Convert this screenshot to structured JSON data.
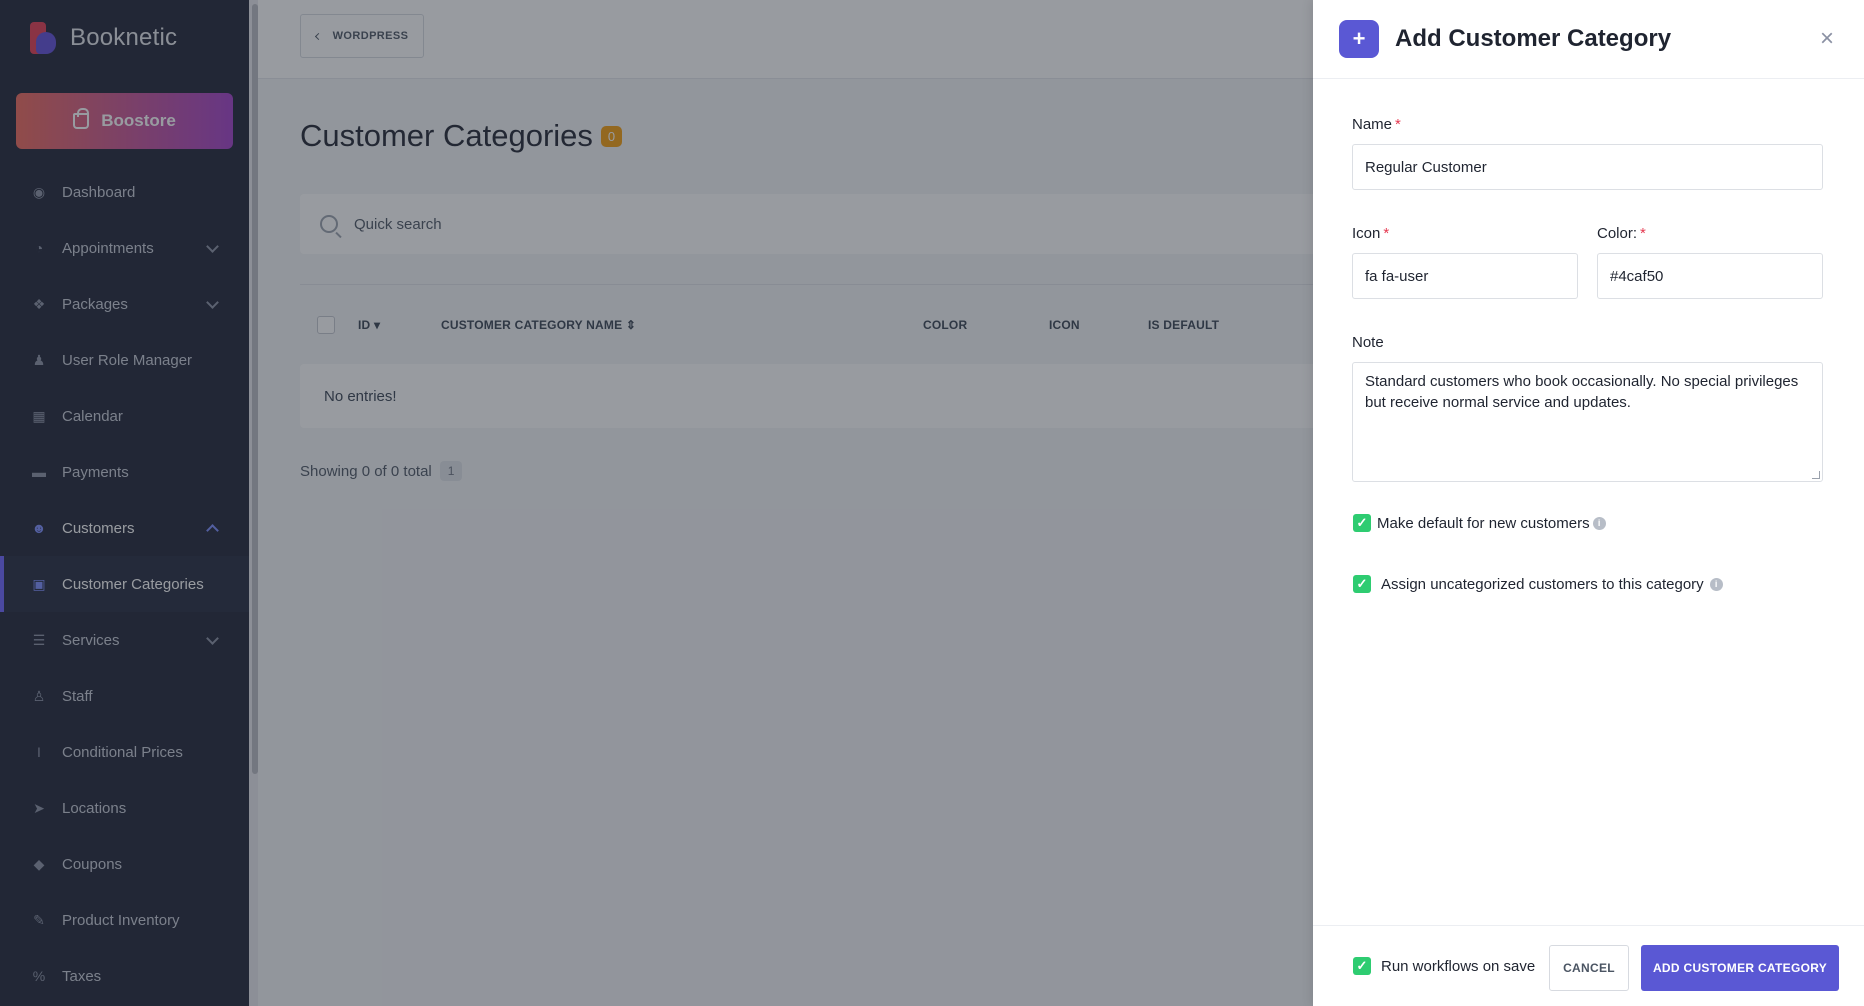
{
  "app": {
    "name": "Booknetic"
  },
  "sidebar": {
    "boostore_label": "Boostore",
    "items": [
      {
        "label": "Dashboard",
        "icon": "dashboard-icon"
      },
      {
        "label": "Appointments",
        "icon": "clock-icon",
        "has_submenu": true
      },
      {
        "label": "Packages",
        "icon": "box-icon",
        "has_submenu": true
      },
      {
        "label": "User Role Manager",
        "icon": "user-role-icon"
      },
      {
        "label": "Calendar",
        "icon": "calendar-icon"
      },
      {
        "label": "Payments",
        "icon": "credit-card-icon"
      },
      {
        "label": "Customers",
        "icon": "users-icon",
        "has_submenu": true,
        "expanded": true
      },
      {
        "label": "Customer Categories",
        "icon": "address-card-icon",
        "active": true
      },
      {
        "label": "Services",
        "icon": "list-icon",
        "has_submenu": true
      },
      {
        "label": "Staff",
        "icon": "user-icon"
      },
      {
        "label": "Conditional Prices",
        "icon": "italic-icon"
      },
      {
        "label": "Locations",
        "icon": "location-arrow-icon"
      },
      {
        "label": "Coupons",
        "icon": "tag-icon"
      },
      {
        "label": "Product Inventory",
        "icon": "tools-icon"
      },
      {
        "label": "Taxes",
        "icon": "percent-icon"
      }
    ]
  },
  "topbar": {
    "wordpress_label": "WORDPRESS"
  },
  "page": {
    "title": "Customer Categories",
    "count": "0",
    "search_placeholder": "Quick search",
    "columns": [
      "ID",
      "CUSTOMER CATEGORY NAME",
      "COLOR",
      "ICON",
      "IS DEFAULT"
    ],
    "empty_text": "No entries!",
    "showing_text": "Showing 0 of 0 total",
    "page_number": "1"
  },
  "drawer": {
    "title": "Add Customer Category",
    "plus_symbol": "+",
    "close_symbol": "×",
    "name_label": "Name",
    "name_value": "Regular Customer",
    "icon_label": "Icon",
    "icon_value": "fa fa-user",
    "color_label": "Color:",
    "color_value": "#4caf50",
    "note_label": "Note",
    "note_value": "Standard customers who book occasionally. No special privileges but receive normal service and updates.",
    "required_mark": "*",
    "checkbox_default_label": "Make default for new customers",
    "checkbox_default_checked": true,
    "checkbox_assign_label": "Assign uncategorized customers to this category",
    "checkbox_assign_checked": true,
    "run_workflows_label": "Run workflows on save",
    "run_workflows_checked": true,
    "cancel_label": "CANCEL",
    "submit_label": "ADD CUSTOMER CATEGORY",
    "info_glyph": "i",
    "check_glyph": "✓"
  },
  "colors": {
    "sidebar_bg": "#1d2235",
    "accent": "#5a58d4",
    "required": "#e53950",
    "checkbox": "#2ecc71",
    "badge": "#f59e0b"
  }
}
